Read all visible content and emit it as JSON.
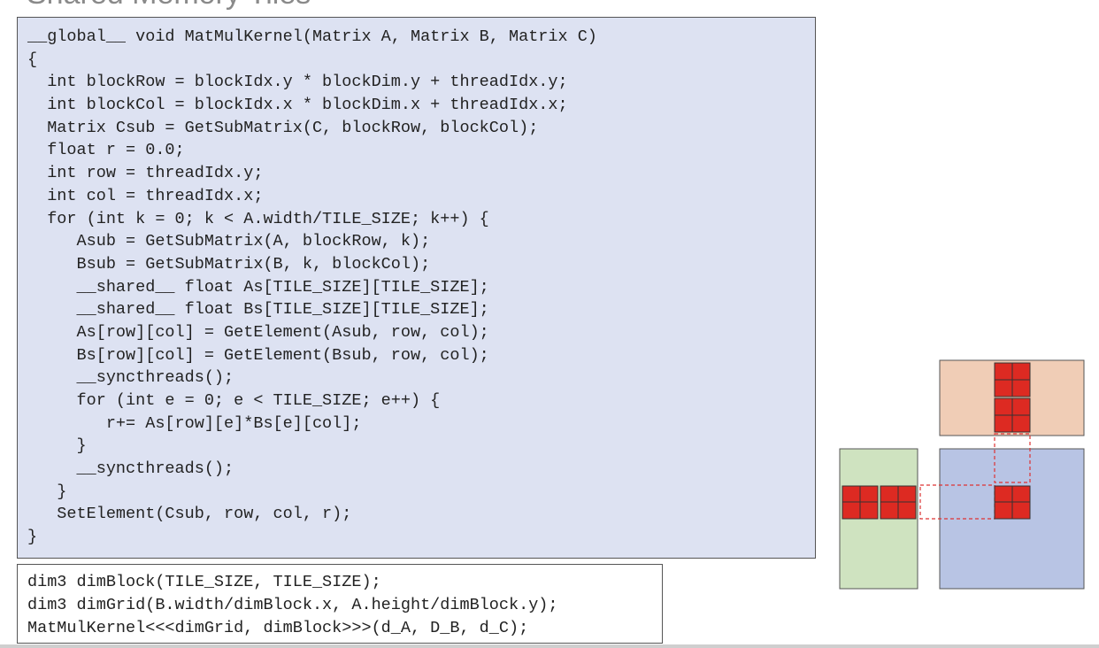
{
  "slide": {
    "title_fragment": "Shared Memory Tiles"
  },
  "kernel_code": [
    "__global__ void MatMulKernel(Matrix A, Matrix B, Matrix C)",
    "{",
    "  int blockRow = blockIdx.y * blockDim.y + threadIdx.y;",
    "  int blockCol = blockIdx.x * blockDim.x + threadIdx.x;",
    "  Matrix Csub = GetSubMatrix(C, blockRow, blockCol);",
    "  float r = 0.0;",
    "  int row = threadIdx.y;",
    "  int col = threadIdx.x;",
    "  for (int k = 0; k < A.width/TILE_SIZE; k++) {",
    "     Asub = GetSubMatrix(A, blockRow, k);",
    "     Bsub = GetSubMatrix(B, k, blockCol);",
    "     __shared__ float As[TILE_SIZE][TILE_SIZE];",
    "     __shared__ float Bs[TILE_SIZE][TILE_SIZE];",
    "     As[row][col] = GetElement(Asub, row, col);",
    "     Bs[row][col] = GetElement(Bsub, row, col);",
    "     __syncthreads();",
    "     for (int e = 0; e < TILE_SIZE; e++) {",
    "        r+= As[row][e]*Bs[e][col];",
    "     }",
    "     __syncthreads();",
    "   }",
    "   SetElement(Csub, row, col, r);",
    "}"
  ],
  "launch_code": [
    "dim3 dimBlock(TILE_SIZE, TILE_SIZE);",
    "dim3 dimGrid(B.width/dimBlock.x, A.height/dimBlock.y);",
    "MatMulKernel<<<dimGrid, dimBlock>>>(d_A, D_B, d_C);"
  ],
  "colors": {
    "code_bg": "#dde2f2",
    "matrix_a": "#cfe3c0",
    "matrix_b": "#f0cdb6",
    "matrix_c": "#b8c4e4",
    "tile": "#dd2a22",
    "dashed": "#dd3333"
  }
}
